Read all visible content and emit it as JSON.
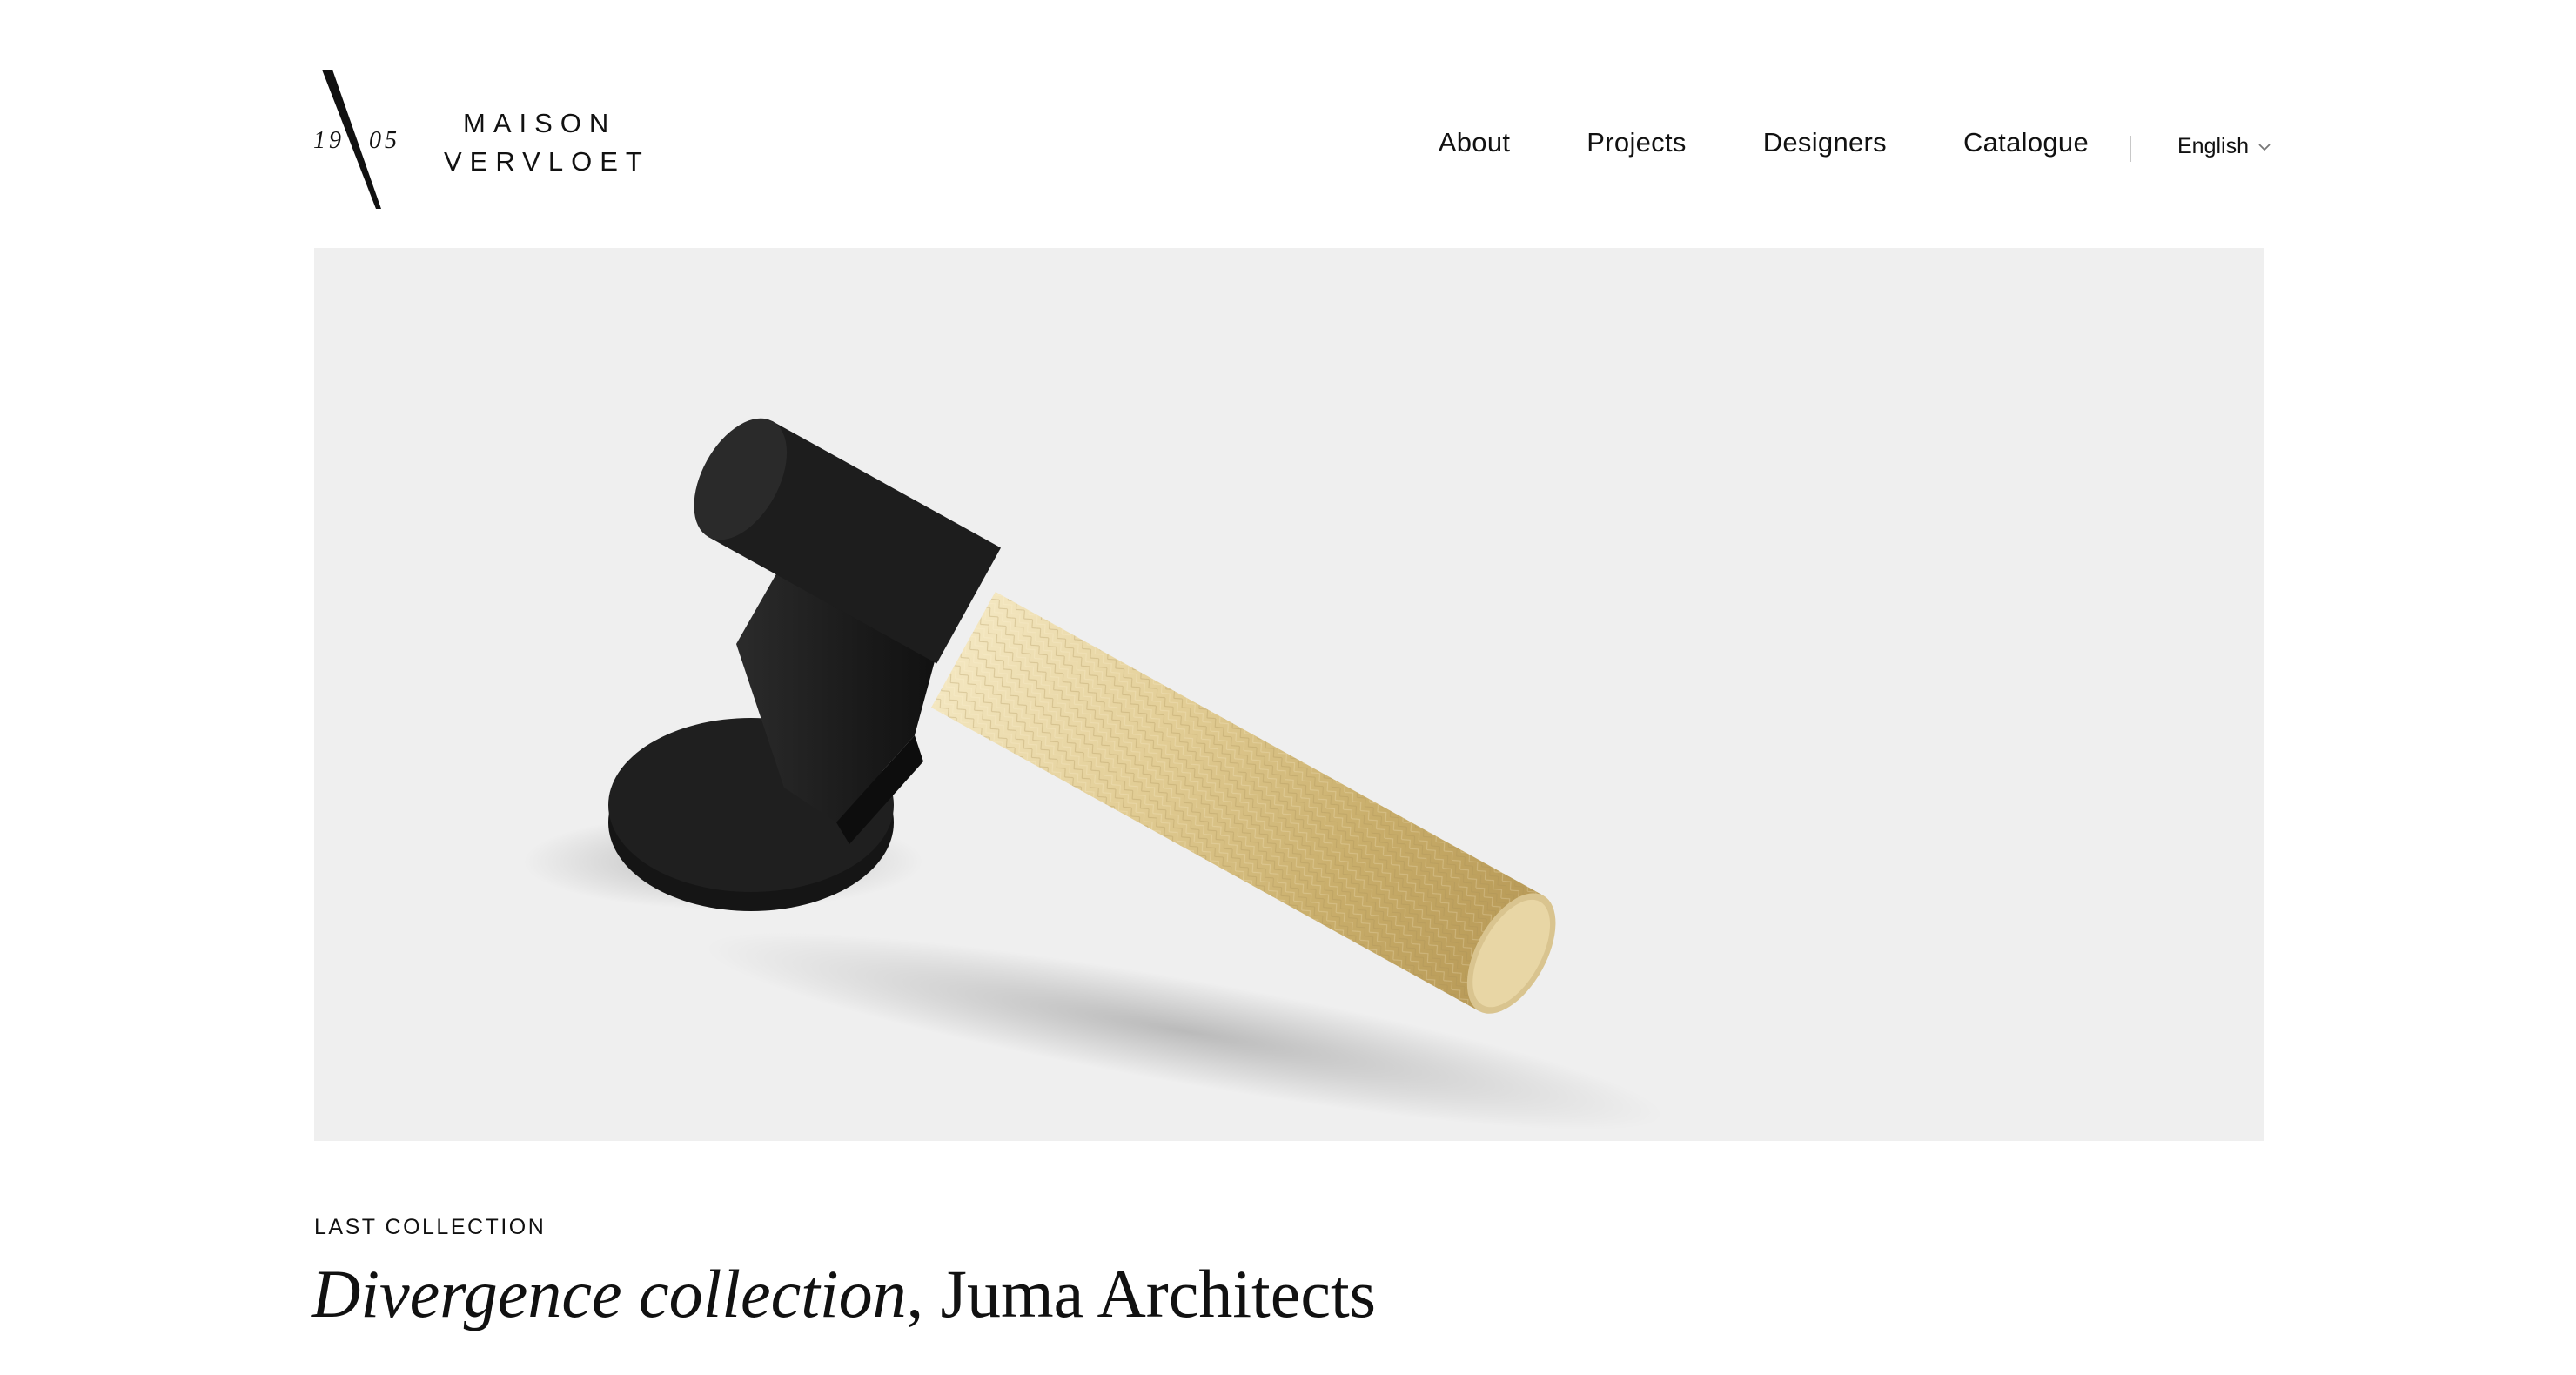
{
  "brand": {
    "name_line1": "MAISON",
    "name_line2": "VERVLOET",
    "year_left": "19",
    "year_right": "05",
    "logo_icon": "slash-monogram-icon"
  },
  "nav": {
    "items": [
      {
        "label": "About"
      },
      {
        "label": "Projects"
      },
      {
        "label": "Designers"
      },
      {
        "label": "Catalogue"
      }
    ]
  },
  "language": {
    "selected": "English",
    "icon": "chevron-down-icon"
  },
  "hero": {
    "image": "door-handle-product-photo",
    "colors": {
      "background": "#efefef",
      "handle_black": "#1c1c1c",
      "handle_brass": "#d9c48f"
    }
  },
  "feature": {
    "eyebrow": "LAST COLLECTION",
    "title_italic": "Divergence collection",
    "title_rest": ", Juma Architects"
  }
}
